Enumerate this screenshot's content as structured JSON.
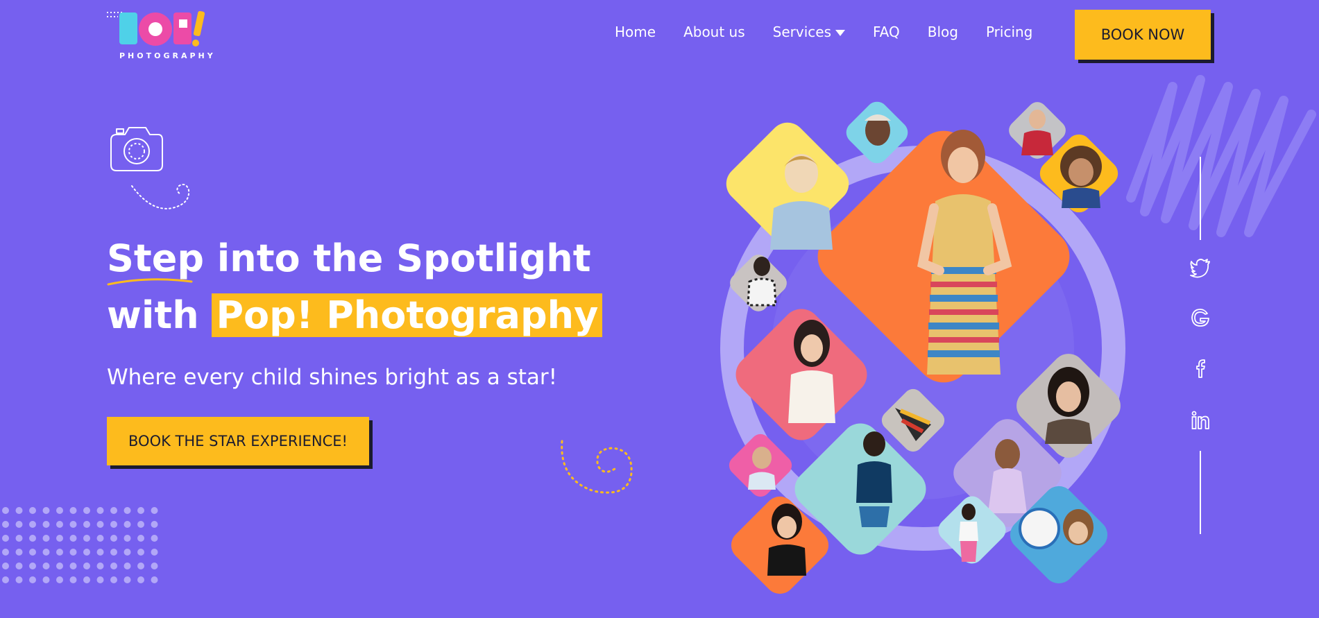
{
  "brand": {
    "logo_text": "POP!",
    "logo_sub": "PHOTOGRAPHY"
  },
  "nav": {
    "items": [
      {
        "label": "Home"
      },
      {
        "label": "About us"
      },
      {
        "label": "Services"
      },
      {
        "label": "FAQ"
      },
      {
        "label": "Blog"
      },
      {
        "label": "Pricing"
      }
    ],
    "cta": "BOOK NOW"
  },
  "hero": {
    "headline_word": "Step",
    "headline_rest": " into the Spotlight",
    "headline_with": "with ",
    "headline_highlight": "Pop! Photography",
    "subhead": "Where every child shines bright as a star!",
    "cta": "BOOK THE STAR EXPERIENCE!"
  },
  "social": [
    "twitter-icon",
    "google-icon",
    "facebook-icon",
    "linkedin-icon"
  ],
  "colors": {
    "background": "#7660ef",
    "accent": "#fdbb1d",
    "ring": "#b2a7f7",
    "dark": "#1b1b2f"
  }
}
